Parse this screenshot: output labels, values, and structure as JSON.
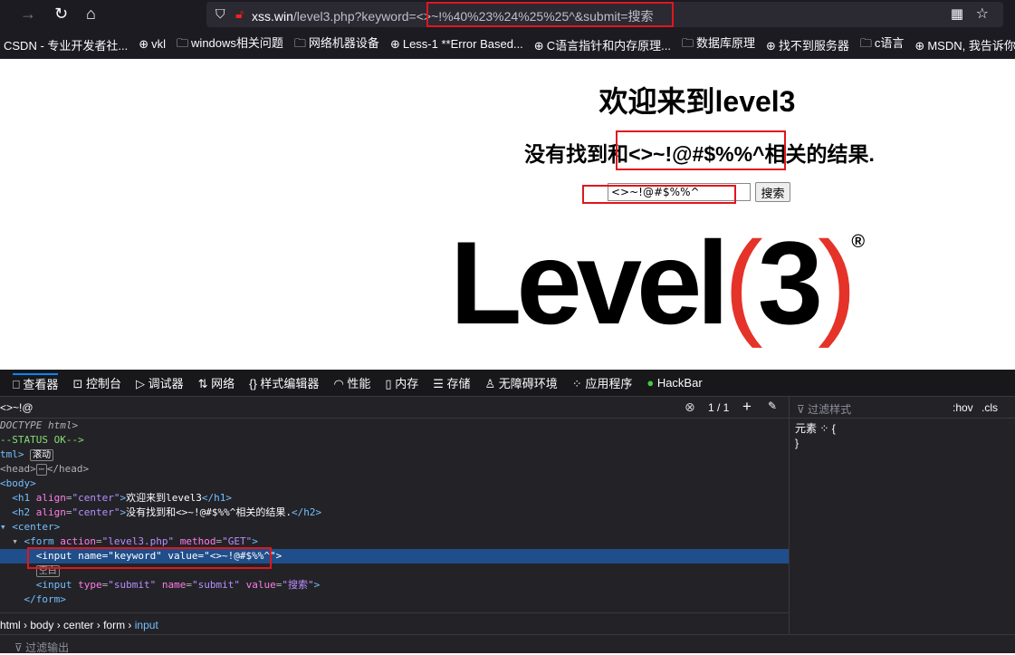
{
  "browser": {
    "url_host": "xss.win",
    "url_path": "/level3.php?keyword=<>~!%40%23%24%25%25^&submit=搜索",
    "bookmarks": [
      "CSDN - 专业开发者社...",
      "vkl",
      "windows相关问题",
      "网络机器设备",
      "Less-1 **Error Based...",
      "C语言指针和内存原理...",
      "数据库原理",
      "找不到服务器",
      "c语言",
      "MSDN, 我告诉你"
    ]
  },
  "page": {
    "h1": "欢迎来到level3",
    "h2": "没有找到和<>~!@#$%%^相关的结果.",
    "keyword_value": "<>~!@#$%%^",
    "submit_label": "搜索",
    "logo_text": "Level",
    "logo_num": "3",
    "logo_reg": "®"
  },
  "devtools": {
    "tabs": [
      "查看器",
      "控制台",
      "调试器",
      "网络",
      "样式编辑器",
      "性能",
      "内存",
      "存储",
      "无障碍环境",
      "应用程序",
      "HackBar"
    ],
    "search_value": "<>~!@",
    "match_count": "1 / 1",
    "filter_styles": "过滤样式",
    "hov": ":hov",
    ".cls": ".cls",
    "rule_selector": "元素",
    "rule_open": "{",
    "rule_close": "}",
    "breadcrumbs": [
      "html",
      "body",
      "center",
      "form",
      "input"
    ],
    "console_filter": "过滤输出",
    "badge_scroll": "滚动",
    "badge_whitespace": "空白"
  }
}
